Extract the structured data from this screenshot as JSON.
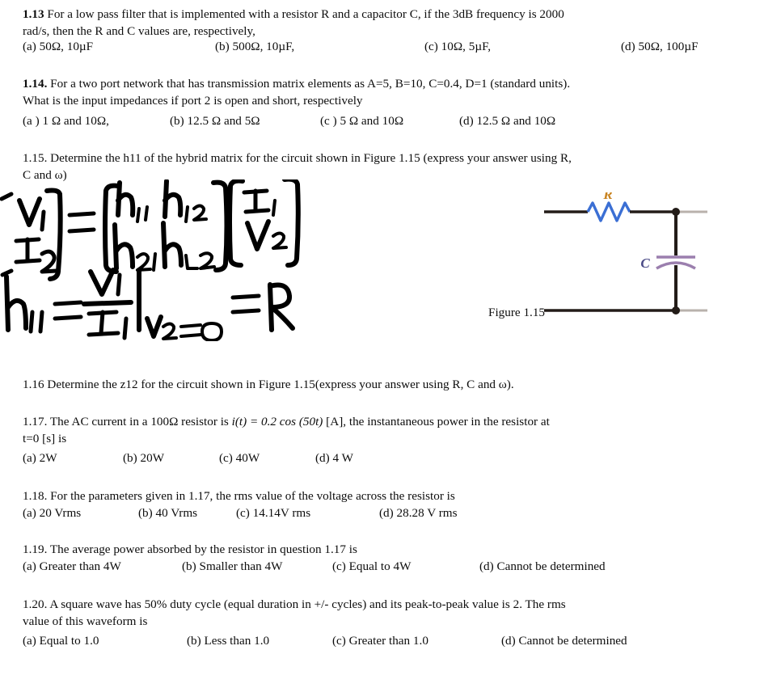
{
  "document": {
    "type": "exam-question-page",
    "page_background": "#ffffff",
    "text_color": "#0d0d0d"
  },
  "questions": [
    {
      "id": "q113",
      "number": "1.13",
      "body_line1": "For a low pass filter that is implemented with a resistor R and a capacitor C, if the 3dB frequency is 2000",
      "body_line2": "rad/s, then the R and C values are, respectively,",
      "options": [
        {
          "label": "(a)",
          "text": "50Ω, 10µF"
        },
        {
          "label": "(b)",
          "text": "500Ω, 10µF,"
        },
        {
          "label": "(c)",
          "text": "10Ω, 5µF,"
        },
        {
          "label": "(d)",
          "text": "50Ω, 100µF"
        }
      ]
    },
    {
      "id": "q114",
      "number": "1.14.",
      "body_line1": "For a two port network that has transmission matrix elements as A=5,  B=10, C=0.4, D=1 (standard units).",
      "body_line2": "What is the input impedances if port 2 is open and short, respectively",
      "options": [
        {
          "label": "(a )",
          "text": "1 Ω and  10Ω,"
        },
        {
          "label": "(b)",
          "text": "12.5 Ω and  5Ω"
        },
        {
          "label": "(c )",
          "text": "5 Ω and  10Ω"
        },
        {
          "label": "(d)",
          "text": "12.5 Ω and  10Ω"
        }
      ]
    },
    {
      "id": "q115",
      "number": "1.15.",
      "body_line1": "Determine the h11 of the hybrid matrix for the  circuit shown in Figure 1.15 (express your answer using R,",
      "body_line2": "C and ω)"
    },
    {
      "id": "q116",
      "number": "1.16",
      "body_line1": "Determine the z12 for the circuit shown in Figure 1.15(express your answer using R, C and ω)."
    },
    {
      "id": "q117",
      "number": "1.17.",
      "body_line1_pre": "The AC current in a  100Ω resistor is ",
      "body_line1_math": "i(t) = 0.2 cos (50t)",
      "body_line1_post": " [A], the instantaneous power in the resistor at",
      "body_line2": "t=0 [s] is",
      "options": [
        {
          "label": "(a)",
          "text": " 2W"
        },
        {
          "label": "(b)",
          "text": "20W"
        },
        {
          "label": "(c)",
          "text": "40W"
        },
        {
          "label": "(d)",
          "text": "4 W"
        }
      ]
    },
    {
      "id": "q118",
      "number": "1.18.",
      "body_line1": "For the parameters given in 1.17, the rms value of the voltage across the resistor is",
      "options": [
        {
          "label": "(a)",
          "text": "20 Vrms"
        },
        {
          "label": "(b)",
          "text": "40 Vrms"
        },
        {
          "label": "(c)",
          "text": "14.14V rms"
        },
        {
          "label": "(d)",
          "text": "28.28 V rms"
        }
      ]
    },
    {
      "id": "q119",
      "number": "1.19.",
      "body_line1": "The average power absorbed by the resistor in question 1.17 is",
      "options": [
        {
          "label": "(a)",
          "text": "Greater than 4W"
        },
        {
          "label": "(b)",
          "text": "Smaller than 4W"
        },
        {
          "label": "(c)",
          "text": "Equal to 4W"
        },
        {
          "label": "(d)",
          "text": "Cannot be determined"
        }
      ]
    },
    {
      "id": "q120",
      "number": "1.20.",
      "body_line1": "A square wave has 50% duty cycle (equal duration in +/- cycles) and its peak-to-peak value is 2. The rms",
      "body_line2": "value of this waveform is",
      "options": [
        {
          "label": "(a)",
          "text": "Equal to 1.0"
        },
        {
          "label": "(b)",
          "text": "Less than 1.0"
        },
        {
          "label": "(c)",
          "text": "Greater than 1.0"
        },
        {
          "label": "(d)",
          "text": "Cannot be determined"
        }
      ]
    }
  ],
  "handwriting": {
    "description": "handwritten hybrid-parameter matrix equation and h11 derivation",
    "ink_color": "#000000",
    "matrix_equation": "[V1; I2] = [h11 h12; h21 h22] [I1; V2]",
    "derivation": "h11 = V1 / I1 |V2=0 = R",
    "tokens": {
      "lhs_top": "V₁",
      "lhs_bottom": "I₂",
      "equals": "=",
      "m11": "h₁₁",
      "m12": "h₁₂",
      "m21": "h₂₁",
      "m22": "h₂₂",
      "rhs_top": "I₁",
      "rhs_bottom": "V₂",
      "result_lhs": "h₁₁",
      "result_num": "V₁",
      "result_den": "I₁",
      "condition": "V₂=0",
      "result": "R"
    }
  },
  "figure": {
    "caption": "Figure 1.15",
    "circuit_type": "RC low pass network",
    "resistor_label": "R",
    "capacitor_label": "C",
    "colors": {
      "wire": "#231c18",
      "resistor": "#3b6fd4",
      "capacitor": "#9b7fae",
      "resistor_label": "#c8821e",
      "capacitor_label": "#4a4a86"
    }
  }
}
